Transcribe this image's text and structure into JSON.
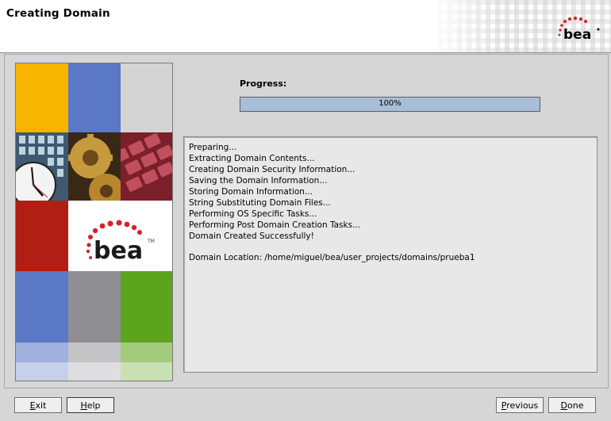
{
  "window": {
    "title": "Creating Domain"
  },
  "brand": {
    "logo_text": "bea"
  },
  "progress": {
    "label": "Progress:",
    "value": 1.0,
    "text": "100%"
  },
  "log": {
    "lines": [
      "Preparing...",
      "Extracting Domain Contents...",
      "Creating Domain Security Information...",
      "Saving the Domain Information...",
      "Storing Domain Information...",
      "String Substituting Domain Files...",
      "Performing OS Specific Tasks...",
      "Performing Post Domain Creation Tasks...",
      "Domain Created Successfully!"
    ],
    "domain_location": "Domain Location: /home/miguel/bea/user_projects/domains/prueba1"
  },
  "buttons": {
    "exit": {
      "mnemonic": "E",
      "rest": "xit"
    },
    "help": {
      "mnemonic": "H",
      "rest": "elp"
    },
    "previous": {
      "mnemonic": "P",
      "rest": "revious"
    },
    "done": {
      "mnemonic": "D",
      "rest": "one"
    }
  },
  "colors": {
    "header_bg": "#ffffff",
    "panel_bg": "#d6d6d6",
    "progress_fill": "#a8bdd8",
    "bea_red": "#d2232a",
    "tile_orange": "#f8b500",
    "tile_blue": "#5b78c6",
    "tile_red": "#b01e14",
    "tile_green": "#5ca31e",
    "tile_gray": "#8e8e93"
  }
}
